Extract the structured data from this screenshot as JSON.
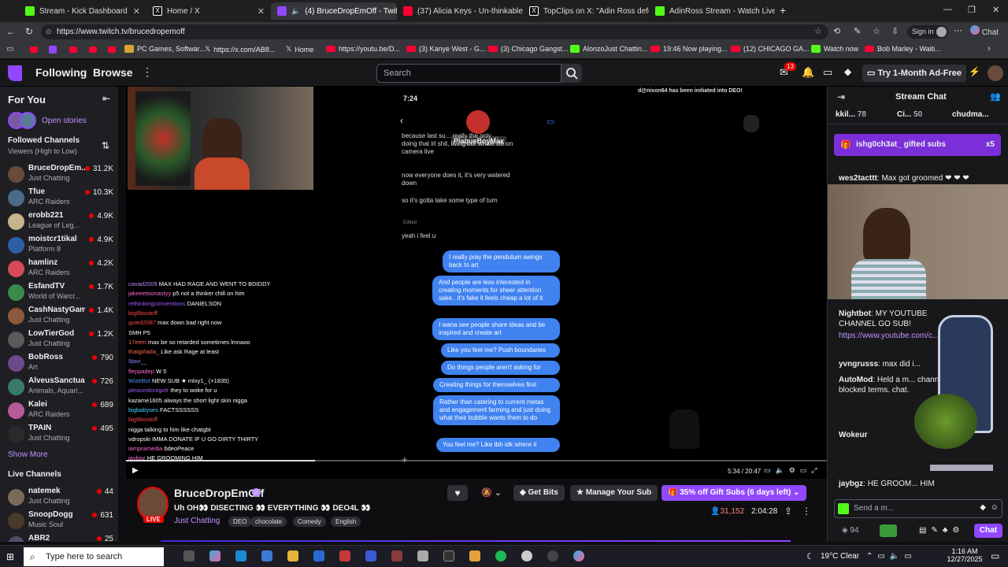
{
  "browser": {
    "tabs": [
      {
        "title": "Stream - Kick Dashboard",
        "color": "#53fc18"
      },
      {
        "title": "Home / X",
        "color": "#ffffff"
      },
      {
        "title": "(4) BruceDropEmOff - Twitch",
        "color": "#9147ff"
      },
      {
        "title": "(37) Alicia Keys - Un-thinkable (I'm",
        "color": "#ff0033"
      },
      {
        "title": "TopClips on X: \"Adin Ross defends",
        "color": "#ffffff"
      },
      {
        "title": "AdinRoss Stream - Watch Live on",
        "color": "#53fc18"
      }
    ],
    "url": "https://www.twitch.tv/brucedropemoff",
    "signin": "Sign in",
    "chat_btn": "Chat",
    "bookmarks": [
      "PC Games, Softwar...",
      "https://x.com/AB8...",
      "Home",
      "https://youtu.be/D...",
      "(3) Kanye West - G...",
      "(3) Chicago Gangst...",
      "AlonzoJust Chattin...",
      "19:46 Now playing...",
      "(12) CHICAGO GA...",
      "Watch now",
      "Bob Marley - Waiti..."
    ]
  },
  "nav": {
    "following": "Following",
    "browse": "Browse",
    "search_placeholder": "Search",
    "notif_count": "13",
    "ad_free": "Try 1-Month Ad-Free"
  },
  "sidebar": {
    "for_you": "For You",
    "open_stories": "Open stories",
    "followed_title": "Followed Channels",
    "followed_sub": "Viewers (High to Low)",
    "channels": [
      {
        "name": "BruceDropEm...",
        "game": "Just Chatting",
        "viewers": "31.2K",
        "color": "#6b4a3a"
      },
      {
        "name": "Tfue",
        "game": "ARC Raiders",
        "viewers": "10.3K",
        "color": "#4a6a8a"
      },
      {
        "name": "erobb221",
        "game": "League of Leg...",
        "viewers": "4.9K",
        "color": "#c8b48a"
      },
      {
        "name": "moistcr1tikal",
        "game": "Platform 8",
        "viewers": "4.9K",
        "color": "#2a5fa8"
      },
      {
        "name": "hamlinz",
        "game": "ARC Raiders",
        "viewers": "4.2K",
        "color": "#d84a5a"
      },
      {
        "name": "EsfandTV",
        "game": "World of Warcr...",
        "viewers": "1.7K",
        "color": "#3a8a4a"
      },
      {
        "name": "CashNastyGam...",
        "game": "Just Chatting",
        "viewers": "1.4K",
        "color": "#8a5a3a"
      },
      {
        "name": "LowTierGod",
        "game": "Just Chatting",
        "viewers": "1.2K",
        "color": "#5a5a5a"
      },
      {
        "name": "BobRoss",
        "game": "Art",
        "viewers": "790",
        "color": "#6a4a8a"
      },
      {
        "name": "AlveusSanctuary",
        "game": "Animals, Aquari...",
        "viewers": "726",
        "color": "#3a7a6a"
      },
      {
        "name": "Kalei",
        "game": "ARC Raiders",
        "viewers": "689",
        "color": "#b85a9a"
      },
      {
        "name": "TPAIN",
        "game": "Just Chatting",
        "viewers": "495",
        "color": "#2a2a2a"
      }
    ],
    "show_more": "Show More",
    "live_title": "Live Channels",
    "live": [
      {
        "name": "natemek",
        "game": "Just Chatting",
        "viewers": "44",
        "color": "#7a6a5a"
      },
      {
        "name": "SnoopDogg",
        "game": "Music Soul",
        "viewers": "631",
        "color": "#4a3a2a"
      },
      {
        "name": "ABR2",
        "game": "",
        "viewers": "25",
        "color": "#5a4a6a"
      }
    ]
  },
  "video": {
    "phone_time": "7:24",
    "phone_user": "PlaqueBoyMax",
    "overlay_banner": "d@nixon64 has been initiated into DEO!",
    "left_msgs": [
      "because last su... really the only ... doing that irl shit, living our whole life on camera live",
      "now everyone does it, it's very watered down",
      "so it's gotta take some type of turn",
      "Edited",
      "yeah i feel u"
    ],
    "right_msgs": [
      "I really pray the pendulum swings back to art",
      "And people are less interested in creating moments for sheer attention sake.. it's fake it feels cheap a lot of it",
      "I wana see people share ideas and be inspired and create art",
      "Like you feel me? Push boundaries",
      "Do things people aren't asking for",
      "Creating things for themselves first",
      "Rather than catering to current metas and engagement farming and just doing what their bubble wants them to do",
      "You feel me? Like tbh idk where it"
    ],
    "stream_chat": [
      {
        "user": "cavad2009",
        "text": "MAX HAD RAGE AND WENT TO BDIDDY",
        "color": "#b68aff"
      },
      {
        "user": "jakeeetoonastyy",
        "text": "p5 not a thinker chill on him",
        "color": "#ff6ad5"
      },
      {
        "user": "rethinkingconventions",
        "text": "DANIELSON",
        "color": "#9e5aff"
      },
      {
        "user": "big6boutoff",
        "text": "",
        "color": "#ff4a4a"
      },
      {
        "user": "guied2087",
        "text": "max down bad right now",
        "color": "#ff4a4a"
      },
      {
        "user": "",
        "text": "SMH P5",
        "color": "#ffffff"
      },
      {
        "user": "17eem",
        "text": "max be so retarded sometimes lmnaoo",
        "color": "#ff6a4a"
      },
      {
        "user": "thatgirlada_",
        "text": "Like ask Rage at least",
        "color": "#ff6a4a"
      },
      {
        "user": "9javi__",
        "text": "",
        "color": "#8a8aff"
      },
      {
        "user": "fleppadep",
        "text": "W 5",
        "color": "#ff6ad5"
      },
      {
        "user": "WizeBot",
        "text": "NEW SUB ★ mlxy1_ (+1835)",
        "color": "#4a9aff"
      },
      {
        "user": "pleaseidontgofr",
        "text": "they to woke for u",
        "color": "#9e5aff"
      },
      {
        "user": "kazame1605",
        "text": "always the short light skin nigga",
        "color": "#ffffff"
      },
      {
        "user": "bigbabyses",
        "text": "FACTSSSSSS",
        "color": "#4ad4ff"
      },
      {
        "user": "big6boutoff",
        "text": "",
        "color": "#ff4a4a"
      },
      {
        "user": "",
        "text": "nigga talking to him like chatgbt",
        "color": "#ffffff"
      },
      {
        "user": "vdropski",
        "text": "IMMA DONATE IF U GO DIRTY THIRTY",
        "color": "#ffffff"
      },
      {
        "user": "iampramedia",
        "text": "bdeoPeace",
        "color": "#ff6ad5"
      },
      {
        "user": "jaybgz",
        "text": "HE GROOMING HIM",
        "color": "#ff6ad5"
      }
    ],
    "time": "5:34 / 20:47"
  },
  "info": {
    "channel": "BruceDropEmOff",
    "title": "Uh OH👀 DISECTING 👀 EVERYTHING 👀 DEO4L 👀",
    "category": "Just Chatting",
    "tags": [
      "DEO",
      "chocolate",
      "Comedy",
      "English"
    ],
    "live": "LIVE",
    "get_bits": "Get Bits",
    "manage_sub": "Manage Your Sub",
    "gift_subs": "35% off Gift Subs (6 days left)",
    "viewers": "31,152",
    "uptime": "2:04:28"
  },
  "chat": {
    "title": "Stream Chat",
    "pinned": [
      {
        "user": "kkil...",
        "count": "78"
      },
      {
        "user": "Ci...",
        "count": "50"
      },
      {
        "user": "chudma...",
        "count": ""
      }
    ],
    "gift_banner": "ishg0ch3at_ gifted subs",
    "gift_count": "x5",
    "messages": [
      {
        "user": "wes2tacttt",
        "text": "Max got groomed ❤ ❤ ❤",
        "color": "#7aa0ff"
      },
      {
        "user": "Nightbot",
        "text": "MY YOUTUBE CHANNEL GO SUB!",
        "color": "#7aa0ff"
      },
      {
        "user": "",
        "text": "https://www.youtube.com/c...",
        "color": "#bf94ff"
      },
      {
        "user": "yvngrusss",
        "text": "max did i...",
        "color": "#b68aff"
      },
      {
        "user": "AutoMod",
        "text": "Held a m... channel blocked terms. chat.",
        "color": "#ff6a4a"
      },
      {
        "user": "Wokeur",
        "text": "",
        "color": "#ff6a4a"
      },
      {
        "user": "jaybgz",
        "text": "HE GROOM... HIM",
        "color": "#ff6ad5"
      }
    ],
    "placeholder": "Send a m...",
    "points": "94",
    "chat_button": "Chat"
  },
  "taskbar": {
    "search": "Type here to search",
    "weather": "19°C  Clear",
    "time": "1:16 AM",
    "date": "12/27/2025"
  }
}
